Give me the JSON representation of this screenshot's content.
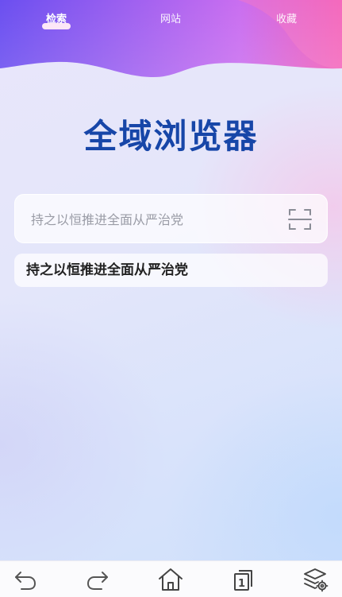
{
  "tabs": [
    {
      "label": "检索",
      "active": true
    },
    {
      "label": "网站",
      "active": false
    },
    {
      "label": "收藏",
      "active": false
    }
  ],
  "app_title": "全域浏览器",
  "search": {
    "placeholder": "持之以恒推进全面从严治党",
    "value": ""
  },
  "suggestions": [
    "持之以恒推进全面从严治党"
  ],
  "icons": {
    "scan": "scan-icon",
    "back": "back-arrow-icon",
    "forward": "forward-arrow-icon",
    "home": "home-icon",
    "tabs": "tabs-icon",
    "settings": "layers-settings-icon"
  },
  "tab_count": "1",
  "colors": {
    "title": "#1746a8",
    "header_gradient_start": "#6d4ef0",
    "header_gradient_end": "#f25fb6"
  }
}
